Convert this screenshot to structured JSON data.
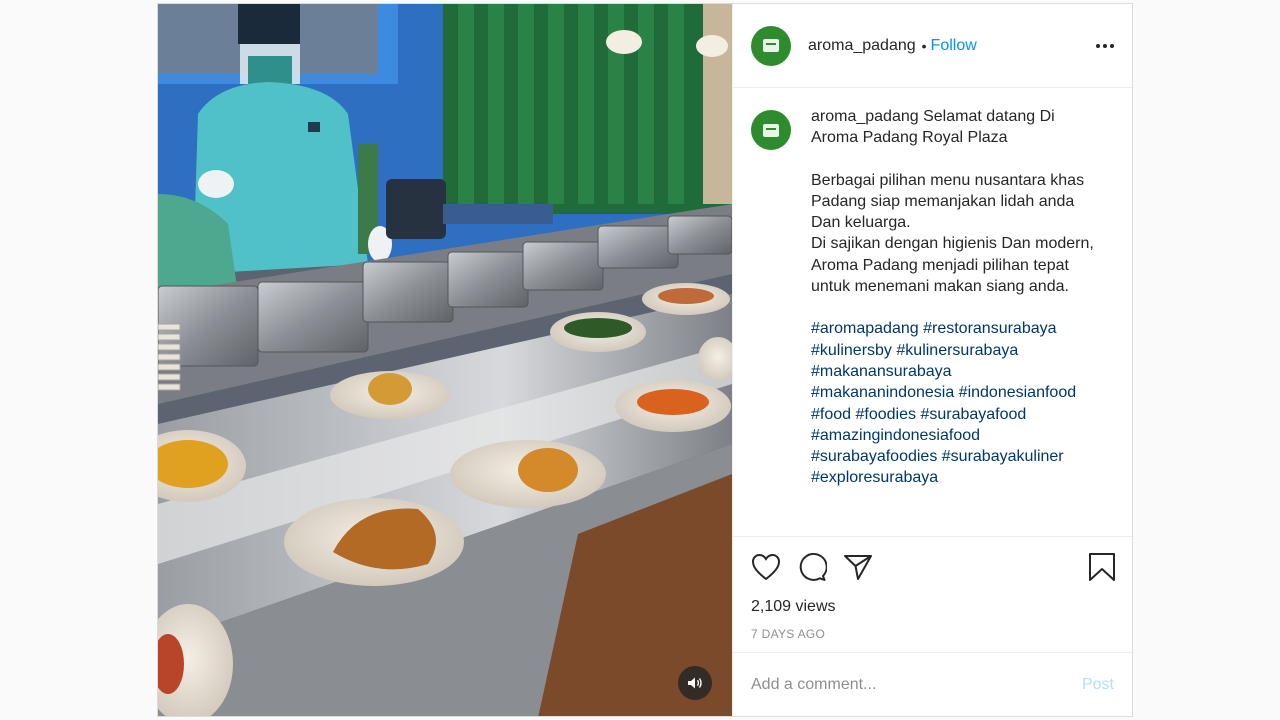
{
  "post": {
    "username": "aroma_padang",
    "follow_separator": "•",
    "follow_label": "Follow",
    "caption_intro": "Selamat datang Di Aroma Padang Royal Plaza",
    "caption_p1": "Berbagai pilihan menu nusantara khas Padang siap memanjakan lidah anda Dan keluarga.\nDi sajikan dengan higienis Dan modern, Aroma Padang menjadi pilihan tepat untuk menemani makan siang anda.",
    "hashtag_lines": [
      [
        "#aromapadang",
        "#restoransurabaya"
      ],
      [
        "#kulinersby",
        "#kulinersurabaya"
      ],
      [
        "#makanansurabaya"
      ],
      [
        "#makananindonesia",
        "#indonesianfood"
      ],
      [
        "#food",
        "#foodies",
        "#surabayafood"
      ],
      [
        "#amazingindonesiafood"
      ],
      [
        "#surabayafoodies",
        "#surabayakuliner"
      ],
      [
        "#exploresurabaya"
      ]
    ],
    "views": "2,109 views",
    "timestamp": "7 DAYS AGO",
    "comment_placeholder": "Add a comment...",
    "post_button": "Post"
  },
  "icons": {
    "more": "more-options-icon",
    "like": "heart-icon",
    "comment": "comment-bubble-icon",
    "share": "paper-plane-icon",
    "save": "bookmark-icon",
    "sound": "speaker-icon"
  },
  "colors": {
    "link": "#0095f6",
    "hashtag": "#00376b",
    "avatar": "#2e8b2e",
    "muted": "#8e8e8e"
  }
}
